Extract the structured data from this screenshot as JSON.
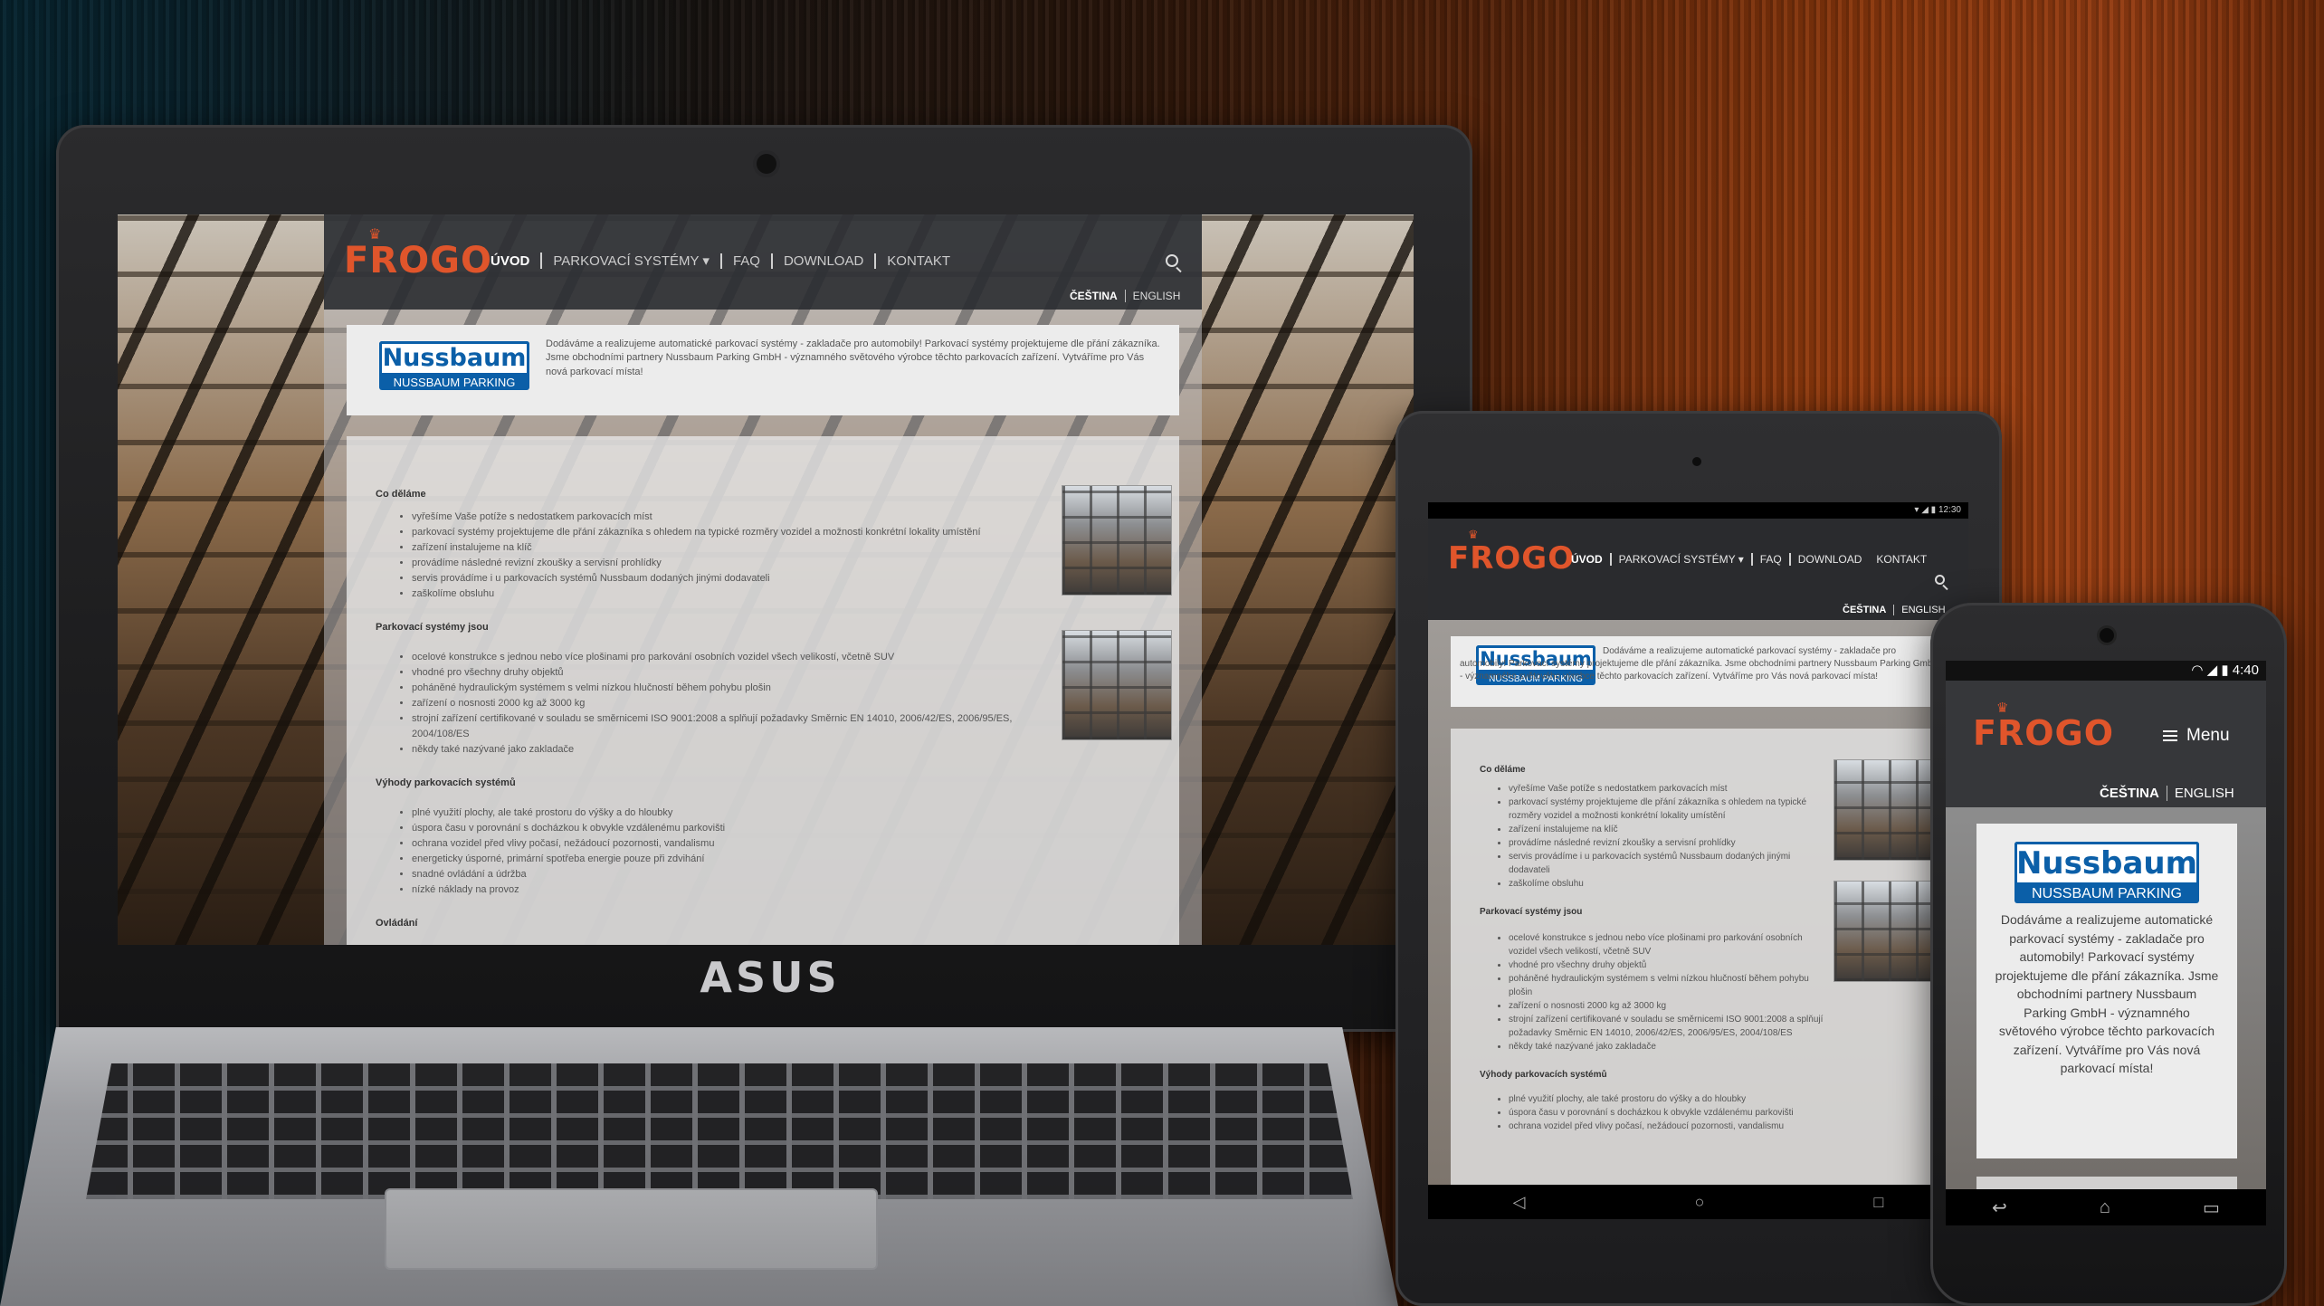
{
  "site": {
    "logo": "FROGO",
    "nav": [
      "ÚVOD",
      "PARKOVACÍ SYSTÉMY",
      "FAQ",
      "DOWNLOAD",
      "KONTAKT"
    ],
    "languages": [
      "ČEŠTINA",
      "ENGLISH"
    ],
    "menu_label": "Menu",
    "partner_logo": {
      "name": "Nussbaum",
      "subtitle": "NUSSBAUM PARKING"
    },
    "intro": "Dodáváme a realizujeme automatické parkovací systémy - zakladače pro automobily! Parkovací systémy projektujeme dle přání zákazníka. Jsme obchodními partnery Nussbaum Parking GmbH - významného světového výrobce těchto parkovacích zařízení. Vytváříme pro Vás nová parkovací místa!",
    "sections": [
      {
        "title": "Co děláme",
        "items": [
          "vyřešíme Vaše potíže s nedostatkem parkovacích míst",
          "parkovací systémy projektujeme dle přání zákazníka s ohledem na typické rozměry vozidel a možnosti konkrétní lokality umístění",
          "zařízení instalujeme na klíč",
          "provádíme následné revizní zkoušky a servisní prohlídky",
          "servis provádíme i u parkovacích systémů Nussbaum dodaných jinými dodavateli",
          "zaškolíme obsluhu"
        ]
      },
      {
        "title": "Parkovací systémy jsou",
        "items": [
          "ocelové konstrukce s jednou nebo více plošinami pro parkování osobních vozidel všech velikostí, včetně SUV",
          "vhodné pro všechny druhy objektů",
          "poháněné hydraulickým systémem s velmi nízkou hlučností během pohybu plošin",
          "zařízení o nosnosti 2000 kg až 3000 kg",
          "strojní zařízení certifikované v souladu se směrnicemi ISO 9001:2008 a splňují požadavky Směrnic EN 14010, 2006/42/ES, 2006/95/ES, 2004/108/ES",
          "někdy také nazývané jako zakladače"
        ]
      },
      {
        "title": "Výhody parkovacích systémů",
        "items": [
          "plné využití plochy, ale také prostoru do výšky a do hloubky",
          "úspora času v porovnání s docházkou k obvykle vzdálenému parkovišti",
          "ochrana vozidel před vlivy počasí, nežádoucí pozornosti, vandalismu",
          "energeticky úsporné, primární spotřeba energie pouze při zdvihání",
          "snadné ovládání a údržba",
          "nízké náklady na provoz"
        ]
      },
      {
        "title": "Ovládání",
        "items": []
      }
    ]
  },
  "devices": {
    "laptop_brand": "ASUS",
    "tablet_time": "12:30",
    "phone_time": "4:40"
  },
  "colors": {
    "accent": "#e0552b",
    "header": "#323438",
    "partner_blue": "#0b5fa8"
  },
  "icons": [
    "search-icon",
    "hamburger-icon",
    "back-icon",
    "home-icon",
    "recents-icon",
    "wifi-icon",
    "battery-icon"
  ]
}
